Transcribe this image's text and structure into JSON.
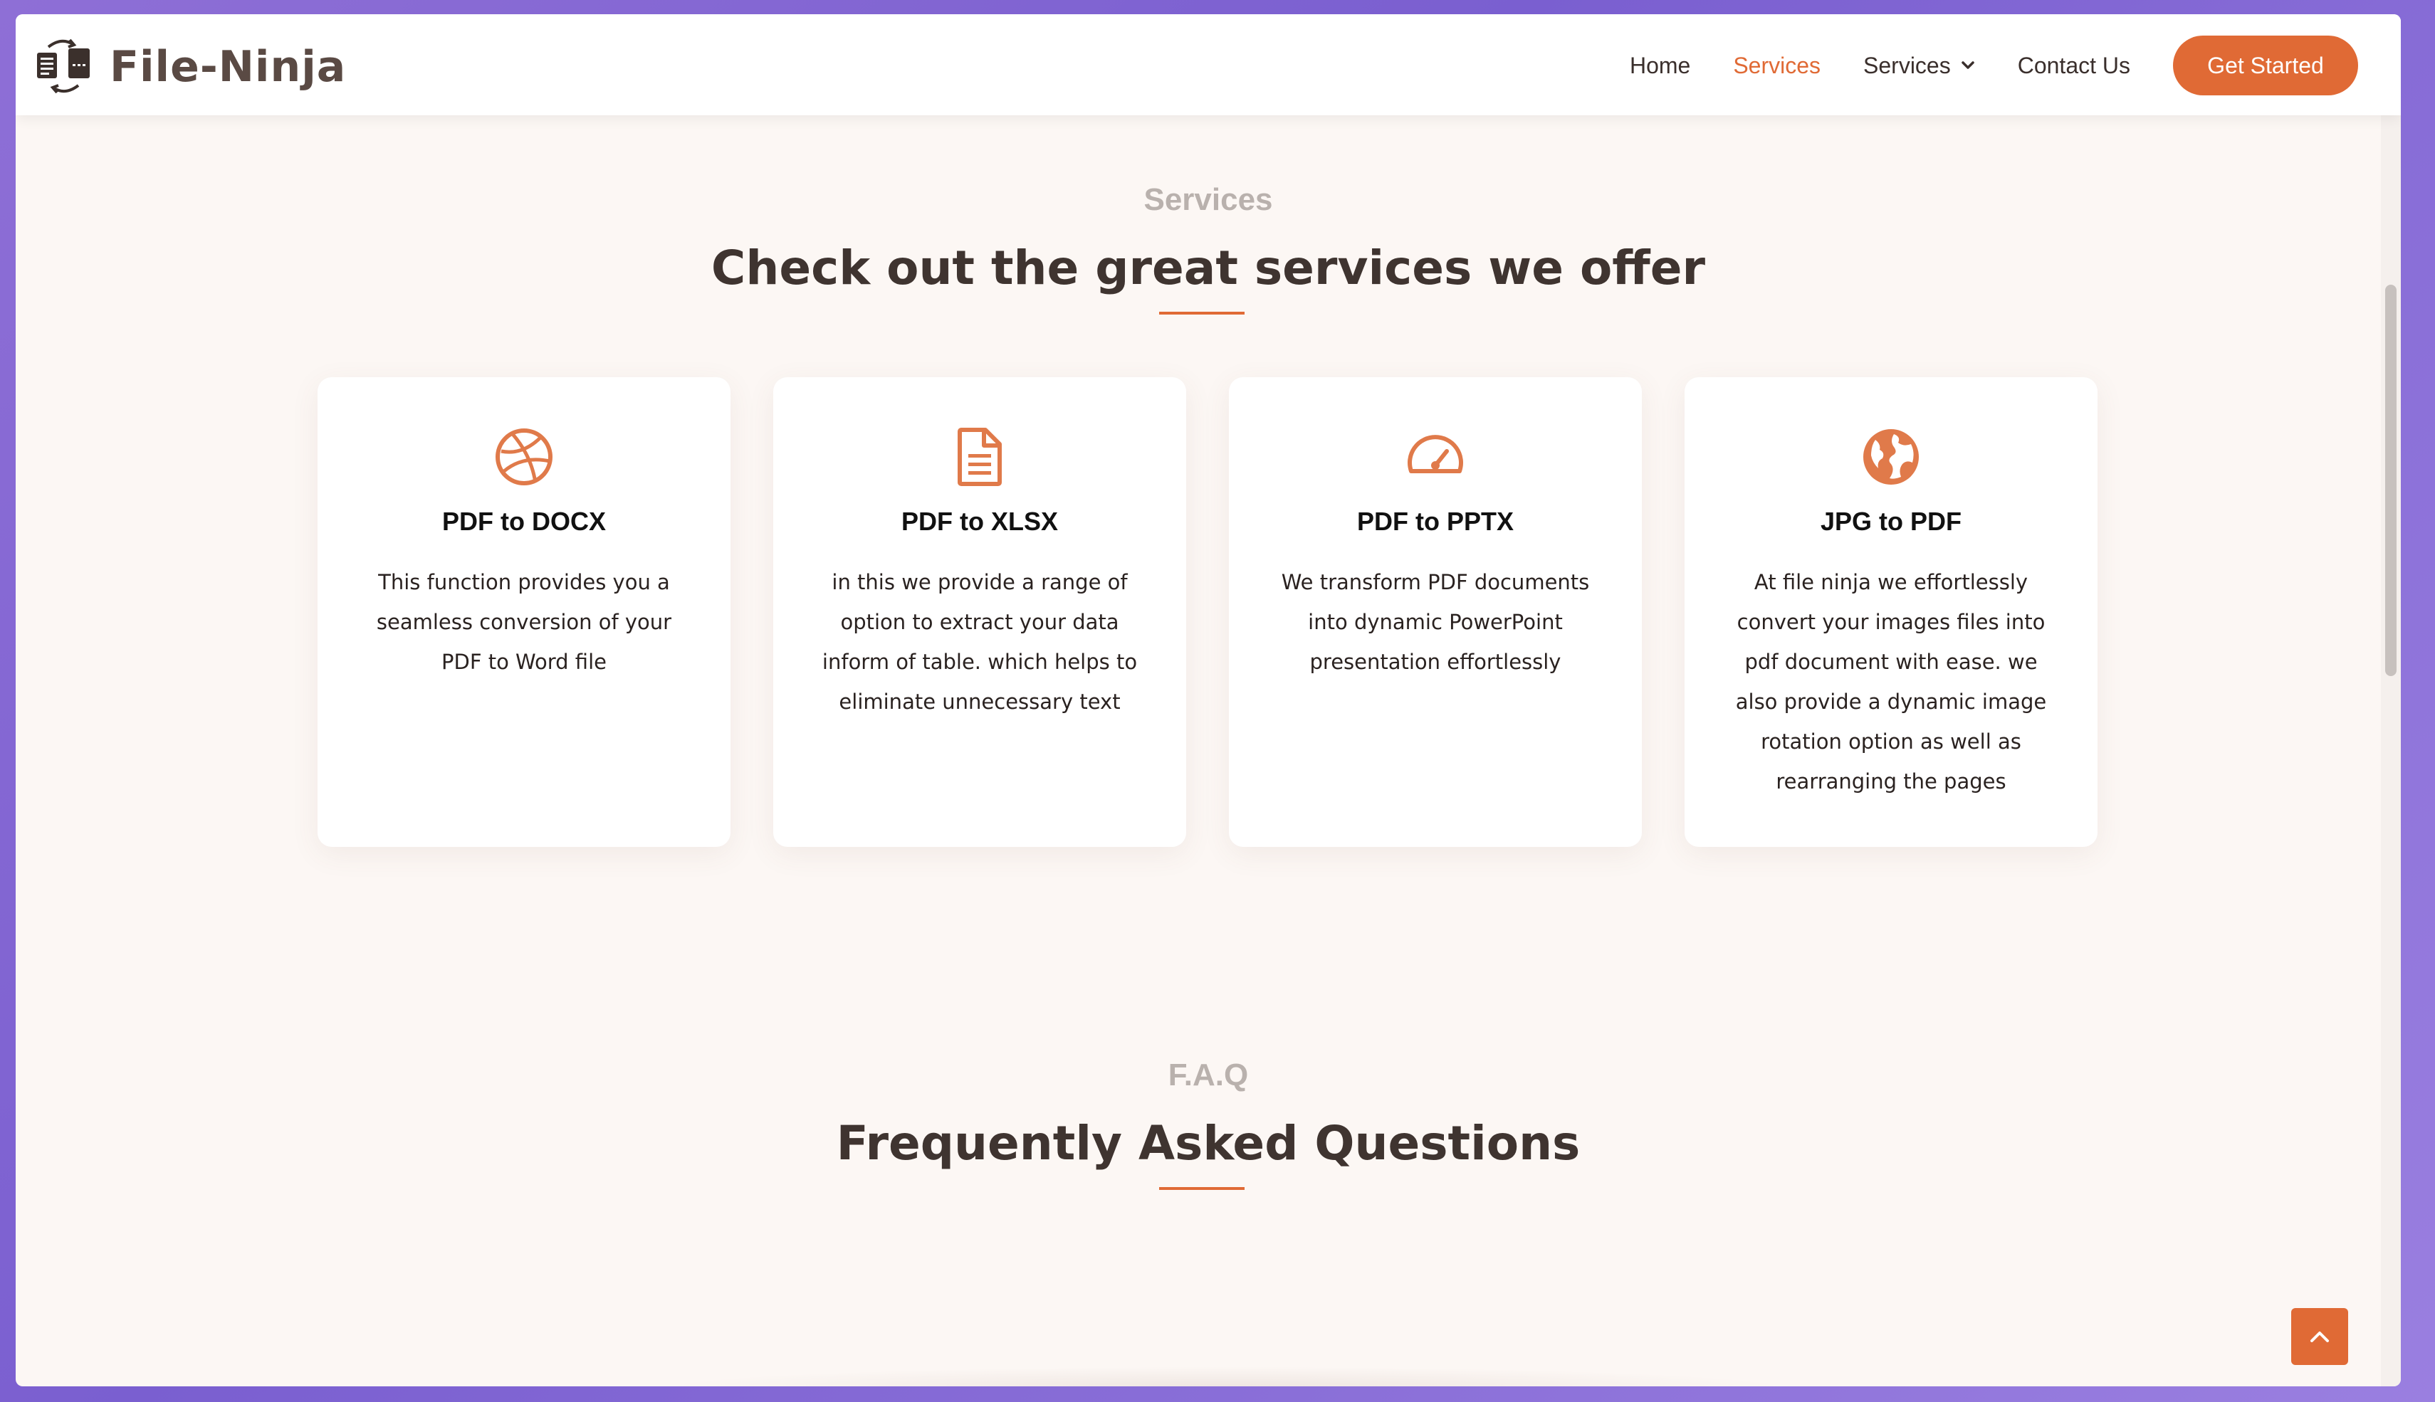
{
  "brand": {
    "name": "File-Ninja",
    "accent": "#e06a35",
    "icon": "file-conversion-logo-icon"
  },
  "nav": {
    "items": [
      {
        "label": "Home",
        "active": false
      },
      {
        "label": "Services",
        "active": true
      },
      {
        "label": "Services",
        "active": false,
        "dropdown": true
      },
      {
        "label": "Contact Us",
        "active": false
      }
    ],
    "cta_label": "Get Started"
  },
  "services": {
    "eyebrow": "Services",
    "title": "Check out the great services we offer",
    "cards": [
      {
        "icon": "dribbble-icon",
        "title": "PDF to DOCX",
        "description": "This function provides you a seamless conversion of your PDF to Word file"
      },
      {
        "icon": "document-icon",
        "title": "PDF to XLSX",
        "description": "in this we provide a range of option to extract your data inform of table. which helps to eliminate unnecessary text"
      },
      {
        "icon": "speedometer-icon",
        "title": "PDF to PPTX",
        "description": "We transform PDF documents into dynamic PowerPoint presentation effortlessly"
      },
      {
        "icon": "globe-icon",
        "title": "JPG to PDF",
        "description": "At file ninja we effortlessly convert your images files into pdf document with ease. we also provide a dynamic image rotation option as well as rearranging the pages"
      }
    ]
  },
  "faq": {
    "eyebrow": "F.A.Q",
    "title": "Frequently Asked Questions"
  },
  "back_to_top_icon": "chevron-up-icon"
}
